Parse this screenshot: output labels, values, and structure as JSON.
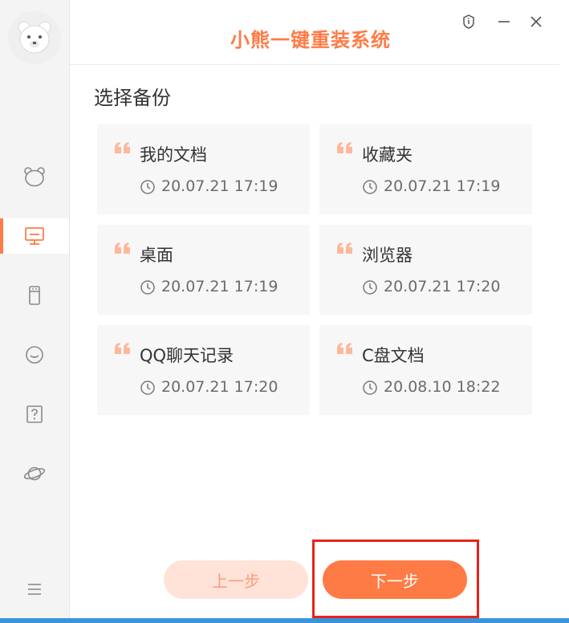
{
  "window": {
    "title": "小熊一键重装系统"
  },
  "section": {
    "title": "选择备份"
  },
  "backups": [
    {
      "name": "我的文档",
      "time": "20.07.21 17:19"
    },
    {
      "name": "收藏夹",
      "time": "20.07.21 17:19"
    },
    {
      "name": "桌面",
      "time": "20.07.21 17:19"
    },
    {
      "name": "浏览器",
      "time": "20.07.21 17:20"
    },
    {
      "name": "QQ聊天记录",
      "time": "20.07.21 17:20"
    },
    {
      "name": "C盘文档",
      "time": "20.08.10 18:22"
    }
  ],
  "buttons": {
    "prev": "上一步",
    "next": "下一步"
  },
  "sidebar": {
    "items": [
      {
        "icon": "bear-icon",
        "active": false
      },
      {
        "icon": "monitor-icon",
        "active": true
      },
      {
        "icon": "usb-drive-icon",
        "active": false
      },
      {
        "icon": "chat-bubble-icon",
        "active": false
      },
      {
        "icon": "help-icon",
        "active": false
      },
      {
        "icon": "planet-icon",
        "active": false
      }
    ],
    "menu_icon": "menu-icon"
  },
  "colors": {
    "accent": "#ff7b45",
    "accent_light": "#ffe3d8",
    "highlight": "#e8231b",
    "card_bg": "#f7f7f7"
  }
}
